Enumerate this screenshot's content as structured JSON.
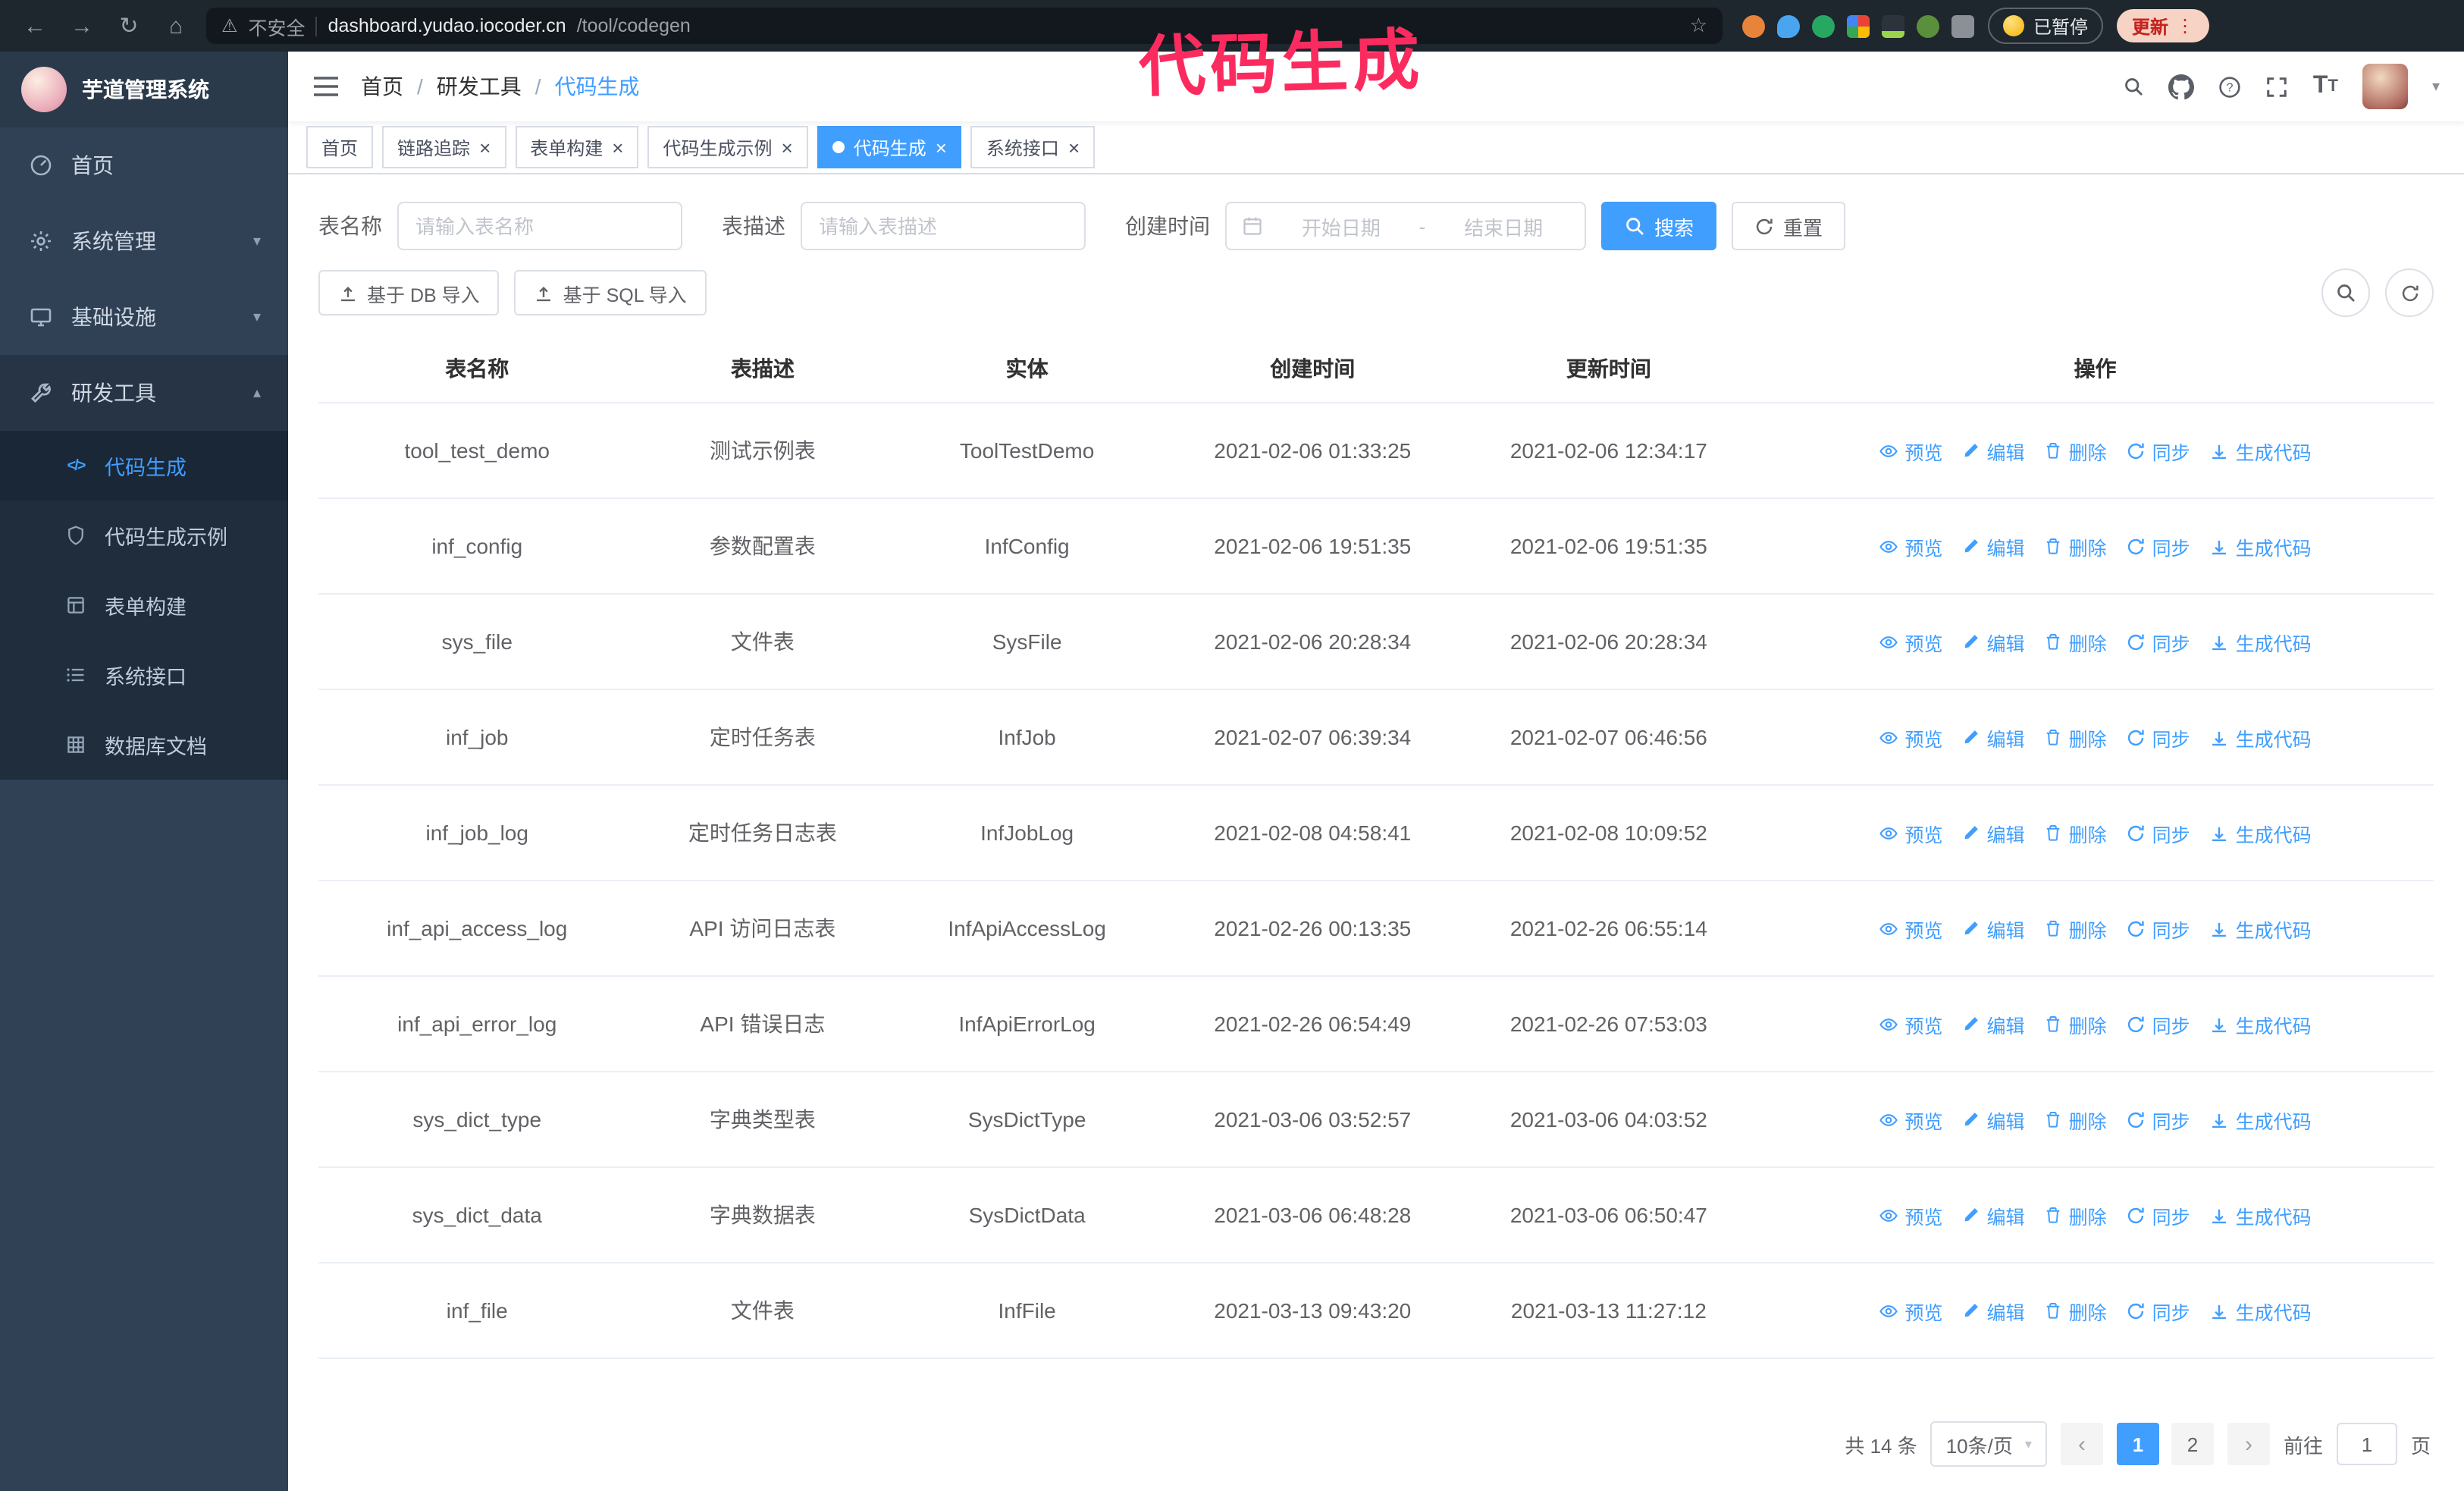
{
  "browser": {
    "security_label": "不安全",
    "url_host": "dashboard.yudao.iocoder.cn",
    "url_path": "/tool/codegen",
    "paused_badge": "已暂停",
    "update_button": "更新"
  },
  "annotation": {
    "text": "代码生成",
    "color": "#fb2b5f"
  },
  "app": {
    "logo_title": "芋道管理系统"
  },
  "sidebar": {
    "items": [
      {
        "id": "home",
        "label": "首页",
        "icon": "dashboard-icon",
        "type": "item"
      },
      {
        "id": "system",
        "label": "系统管理",
        "icon": "gear-icon",
        "type": "group",
        "expanded": false
      },
      {
        "id": "infra",
        "label": "基础设施",
        "icon": "infra-icon",
        "type": "group",
        "expanded": false
      },
      {
        "id": "devtools",
        "label": "研发工具",
        "icon": "tools-icon",
        "type": "group",
        "expanded": true,
        "children": [
          {
            "id": "codegen",
            "label": "代码生成",
            "icon": "code-icon",
            "active": true
          },
          {
            "id": "codegen-example",
            "label": "代码生成示例",
            "icon": "shield-icon"
          },
          {
            "id": "form-builder",
            "label": "表单构建",
            "icon": "form-icon"
          },
          {
            "id": "api",
            "label": "系统接口",
            "icon": "api-icon"
          },
          {
            "id": "db-doc",
            "label": "数据库文档",
            "icon": "grid-icon"
          }
        ]
      }
    ]
  },
  "header": {
    "breadcrumb": {
      "items": [
        "首页",
        "研发工具",
        "代码生成"
      ],
      "separator": "/"
    }
  },
  "tabs": [
    {
      "id": "home",
      "label": "首页",
      "closable": false,
      "active": false
    },
    {
      "id": "tracer",
      "label": "链路追踪",
      "closable": true,
      "active": false
    },
    {
      "id": "form-builder",
      "label": "表单构建",
      "closable": true,
      "active": false
    },
    {
      "id": "codegen-example",
      "label": "代码生成示例",
      "closable": true,
      "active": false
    },
    {
      "id": "codegen",
      "label": "代码生成",
      "closable": true,
      "active": true
    },
    {
      "id": "api",
      "label": "系统接口",
      "closable": true,
      "active": false
    }
  ],
  "filters": {
    "table_name_label": "表名称",
    "table_name_placeholder": "请输入表名称",
    "table_desc_label": "表描述",
    "table_desc_placeholder": "请输入表描述",
    "create_time_label": "创建时间",
    "date_start_placeholder": "开始日期",
    "date_separator": "-",
    "date_end_placeholder": "结束日期",
    "search_button": "搜索",
    "reset_button": "重置"
  },
  "toolbar": {
    "import_db_button": "基于 DB 导入",
    "import_sql_button": "基于 SQL 导入"
  },
  "table": {
    "columns": [
      "表名称",
      "表描述",
      "实体",
      "创建时间",
      "更新时间",
      "操作"
    ],
    "actions": [
      {
        "id": "preview",
        "label": "预览",
        "icon": "eye-icon"
      },
      {
        "id": "edit",
        "label": "编辑",
        "icon": "edit-icon"
      },
      {
        "id": "delete",
        "label": "删除",
        "icon": "trash-icon"
      },
      {
        "id": "sync",
        "label": "同步",
        "icon": "sync-icon"
      },
      {
        "id": "generate",
        "label": "生成代码",
        "icon": "download-icon"
      }
    ],
    "rows": [
      {
        "name": "tool_test_demo",
        "desc": "测试示例表",
        "entity": "ToolTestDemo",
        "created": "2021-02-06 01:33:25",
        "updated": "2021-02-06 12:34:17"
      },
      {
        "name": "inf_config",
        "desc": "参数配置表",
        "entity": "InfConfig",
        "created": "2021-02-06 19:51:35",
        "updated": "2021-02-06 19:51:35"
      },
      {
        "name": "sys_file",
        "desc": "文件表",
        "entity": "SysFile",
        "created": "2021-02-06 20:28:34",
        "updated": "2021-02-06 20:28:34"
      },
      {
        "name": "inf_job",
        "desc": "定时任务表",
        "entity": "InfJob",
        "created": "2021-02-07 06:39:34",
        "updated": "2021-02-07 06:46:56"
      },
      {
        "name": "inf_job_log",
        "desc": "定时任务日志表",
        "entity": "InfJobLog",
        "created": "2021-02-08 04:58:41",
        "updated": "2021-02-08 10:09:52"
      },
      {
        "name": "inf_api_access_log",
        "desc": "API 访问日志表",
        "entity": "InfApiAccessLog",
        "created": "2021-02-26 00:13:35",
        "updated": "2021-02-26 06:55:14"
      },
      {
        "name": "inf_api_error_log",
        "desc": "API 错误日志",
        "entity": "InfApiErrorLog",
        "created": "2021-02-26 06:54:49",
        "updated": "2021-02-26 07:53:03"
      },
      {
        "name": "sys_dict_type",
        "desc": "字典类型表",
        "entity": "SysDictType",
        "created": "2021-03-06 03:52:57",
        "updated": "2021-03-06 04:03:52"
      },
      {
        "name": "sys_dict_data",
        "desc": "字典数据表",
        "entity": "SysDictData",
        "created": "2021-03-06 06:48:28",
        "updated": "2021-03-06 06:50:47"
      },
      {
        "name": "inf_file",
        "desc": "文件表",
        "entity": "InfFile",
        "created": "2021-03-13 09:43:20",
        "updated": "2021-03-13 11:27:12"
      }
    ]
  },
  "pagination": {
    "total_text": "共 14 条",
    "page_size_text": "10条/页",
    "pages": [
      "1",
      "2"
    ],
    "active_page": "1",
    "goto_label": "前往",
    "goto_value": "1",
    "goto_suffix": "页"
  },
  "icons": {
    "back-icon": "←",
    "forward-icon": "→",
    "reload-icon": "↻",
    "home-icon": "⌂",
    "warning-icon": "⚠",
    "star-icon": "☆",
    "kebab-icon": "⋮",
    "caret-down-icon": "▾",
    "chevron-down-icon": "▾",
    "chevron-up-icon": "▴",
    "close-icon": "×",
    "prev-icon": "‹",
    "next-icon": "›",
    "code-icon": "</>"
  },
  "colors": {
    "primary": "#409EFF",
    "sidebar_bg": "#304156",
    "submenu_bg": "#1f2d3d",
    "annotation": "#fb2b5f"
  }
}
